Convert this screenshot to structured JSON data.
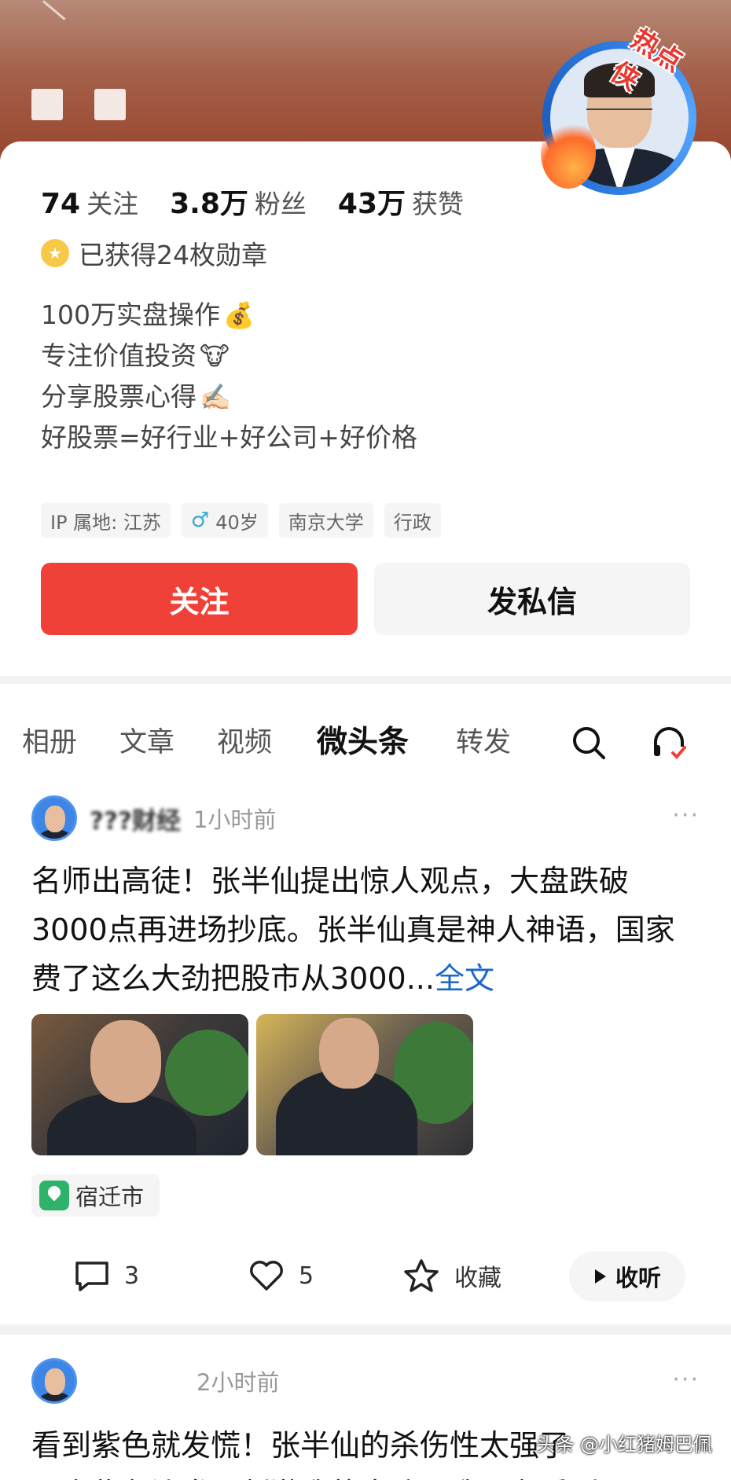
{
  "profile": {
    "badge": "热点侠",
    "stats": [
      {
        "num": "74",
        "label": "关注"
      },
      {
        "num": "3.8万",
        "label": "粉丝"
      },
      {
        "num": "43万",
        "label": "获赞"
      }
    ],
    "medal_text": "已获得24枚勋章",
    "bio": [
      {
        "text": "100万实盘操作",
        "emoji": "💰"
      },
      {
        "text": "专注价值投资",
        "emoji": "🐮"
      },
      {
        "text": "分享股票心得",
        "emoji": "✍🏻"
      },
      {
        "text": "好股票=好行业+好公司+好价格",
        "emoji": ""
      }
    ],
    "tags": [
      "IP 属地: 江苏",
      "40岁",
      "南京大学",
      "行政"
    ],
    "follow_label": "关注",
    "message_label": "发私信"
  },
  "tabs": [
    "相册",
    "文章",
    "视频",
    "微头条",
    "转发"
  ],
  "active_tab": "微头条",
  "post1": {
    "author": "???财经",
    "time": "1小时前",
    "more": "···",
    "text": "名师出高徒！张半仙提出惊人观点，大盘跌破3000点再进场抄底。张半仙真是神人神语，国家费了这么大劲把股市从3000...",
    "full_label": "全文",
    "location": "宿迁市",
    "comments": "3",
    "likes": "5",
    "favorite_label": "收藏",
    "listen_label": "收听"
  },
  "post2": {
    "time": "2小时前",
    "more": "···",
    "text": "看到紫色就发慌！张半仙的杀伤性太强了",
    "text2": "一次紫色边发，刺激我的大脑，我现在看到"
  },
  "watermark": "头条 @小红猪姆巴佩",
  "colors": {
    "accent_red": "#f04138",
    "link_blue": "#1a66c9",
    "badge_red": "#e8382e"
  },
  "icons": [
    "medal-icon",
    "search-icon",
    "headphone-icon",
    "comment-icon",
    "heart-icon",
    "star-icon",
    "play-icon",
    "location-icon",
    "more-icon"
  ]
}
